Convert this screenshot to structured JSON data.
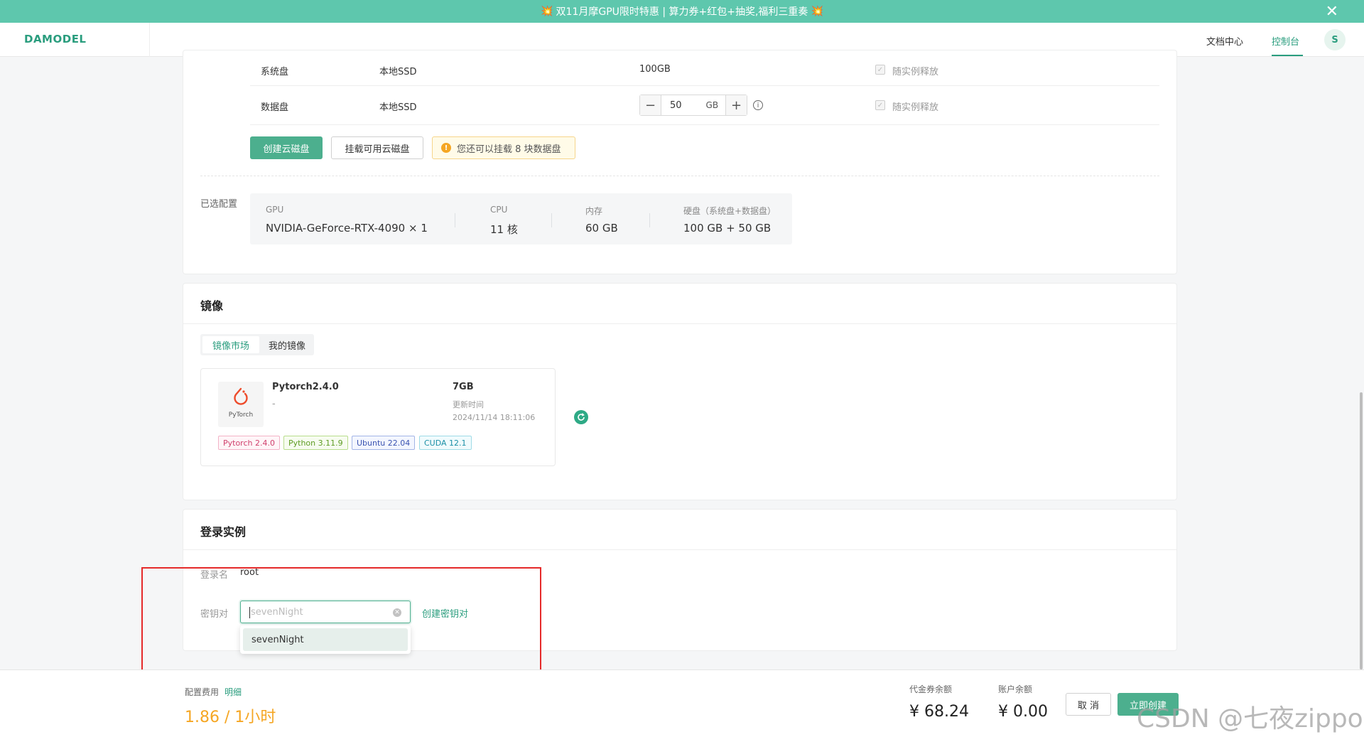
{
  "promo": {
    "icon_left": "💥",
    "text": "双11月摩GPU限时特惠 | 算力券+红包+抽奖,福利三重奏",
    "icon_right": "💥",
    "close": "✕"
  },
  "nav": {
    "logo": "DAMODEL",
    "docs": "文档中心",
    "console": "控制台",
    "avatar": "S"
  },
  "disk": {
    "system": {
      "label": "系统盘",
      "type": "本地SSD",
      "size": "100GB",
      "release": "随实例释放"
    },
    "data": {
      "label": "数据盘",
      "type": "本地SSD",
      "value": "50",
      "unit": "GB",
      "release": "随实例释放"
    },
    "create_button": "创建云磁盘",
    "mount_button": "挂载可用云磁盘",
    "warning": "您还可以挂载 8 块数据盘"
  },
  "config": {
    "label": "已选配置",
    "gpu_label": "GPU",
    "gpu_value": "NVIDIA-GeForce-RTX-4090 × 1",
    "cpu_label": "CPU",
    "cpu_value": "11 核",
    "mem_label": "内存",
    "mem_value": "60 GB",
    "disk_label": "硬盘（系统盘+数据盘）",
    "disk_value": "100 GB + 50 GB"
  },
  "image": {
    "title": "镜像",
    "tabs": [
      "镜像市场",
      "我的镜像"
    ],
    "card": {
      "name": "Pytorch2.4.0",
      "desc": "-",
      "size": "7GB",
      "updated_label": "更新时间",
      "updated_value": "2024/11/14 18:11:06",
      "logo_text": "PyTorch",
      "tags": [
        "Pytorch 2.4.0",
        "Python 3.11.9",
        "Ubuntu 22.04",
        "CUDA 12.1"
      ]
    }
  },
  "login": {
    "title": "登录实例",
    "name_label": "登录名",
    "name_value": "root",
    "key_label": "密钥对",
    "key_placeholder": "sevenNight",
    "create_key_link": "创建密钥对",
    "dropdown_options": [
      "sevenNight"
    ]
  },
  "footer": {
    "fee_label": "配置费用",
    "detail_link": "明细",
    "price": "1.86 / 1小时",
    "voucher_label": "代金券余额",
    "voucher_value": "¥ 68.24",
    "balance_label": "账户余额",
    "balance_value": "¥ 0.00",
    "cancel_button": "取 消",
    "create_button": "立即创建"
  },
  "watermark": "CSDN @七夜zippoe",
  "colors": {
    "brand": "#2a9d7e",
    "primary_button": "#4caf8e",
    "promo": "#5ec7ad",
    "price": "#f5a623",
    "annotation": "#e52a2a"
  }
}
